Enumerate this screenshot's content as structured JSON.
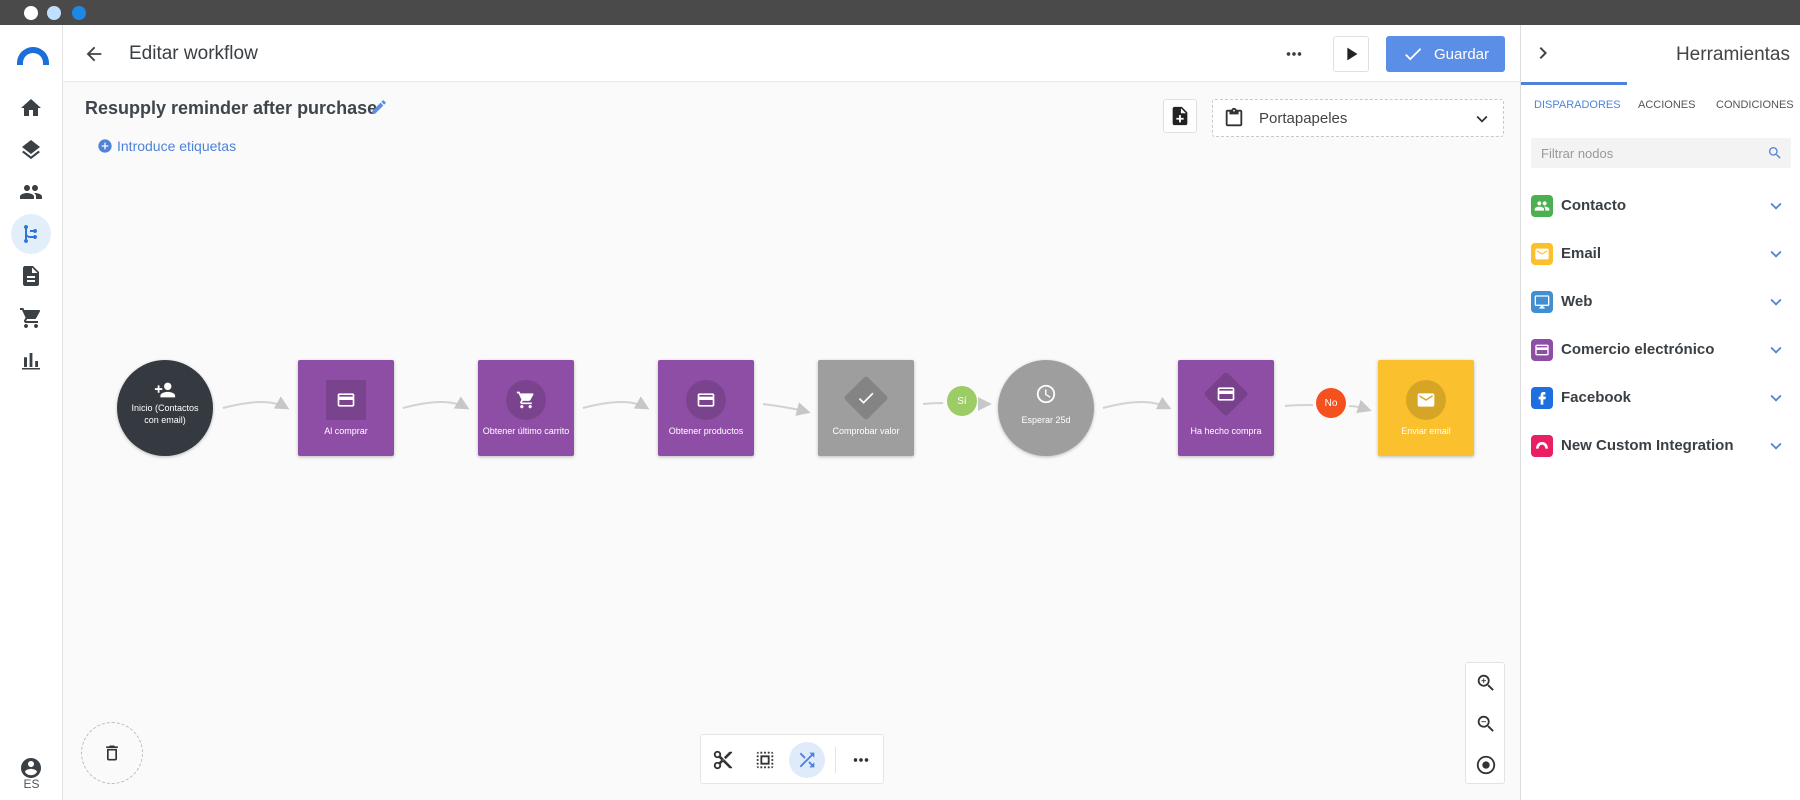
{
  "window": {
    "dots": [
      "#ffffff",
      "#bfe0ff",
      "#1e88e5"
    ]
  },
  "nav": {
    "items": [
      {
        "icon": "home-icon"
      },
      {
        "icon": "layers-icon"
      },
      {
        "icon": "people-icon"
      },
      {
        "icon": "workflow-icon",
        "active": true
      },
      {
        "icon": "document-icon"
      },
      {
        "icon": "cart-icon"
      },
      {
        "icon": "bar-chart-icon"
      }
    ],
    "language": "ES"
  },
  "header": {
    "title": "Editar workflow",
    "save_label": "Guardar"
  },
  "workflow": {
    "name": "Resupply reminder after purchase",
    "tags_link": "Introduce etiquetas",
    "clipboard_label": "Portapapeles",
    "nodes": [
      {
        "id": "inicio",
        "label": "Inicio (Contactos con email)",
        "shape": "circle",
        "color": "#343a40",
        "icon": "person-add-icon"
      },
      {
        "id": "al-comprar",
        "label": "Al comprar",
        "shape": "square",
        "color": "#8e4ea6",
        "icon": "credit-card-icon"
      },
      {
        "id": "obtener-carrito",
        "label": "Obtener último carrito",
        "shape": "square",
        "color": "#8e4ea6",
        "icon": "cart-icon"
      },
      {
        "id": "obtener-productos",
        "label": "Obtener productos",
        "shape": "square",
        "color": "#8e4ea6",
        "icon": "credit-card-icon"
      },
      {
        "id": "comprobar-valor",
        "label": "Comprobar valor",
        "shape": "square",
        "color": "#9e9e9e",
        "icon": "check-icon"
      },
      {
        "id": "esperar",
        "label": "Esperar 25d",
        "shape": "circle",
        "color": "#9e9e9e",
        "icon": "clock-icon"
      },
      {
        "id": "ha-hecho-compra",
        "label": "Ha hecho compra",
        "shape": "square",
        "color": "#8e4ea6",
        "icon": "credit-card-icon"
      },
      {
        "id": "enviar-email",
        "label": "Enviar email",
        "shape": "square",
        "color": "#fbc02d",
        "icon": "mail-icon"
      }
    ],
    "branch_badges": [
      {
        "label": "Sí",
        "color": "#9ccc65"
      },
      {
        "label": "No",
        "color": "#f4511e"
      }
    ]
  },
  "tools_panel": {
    "title": "Herramientas",
    "tabs": [
      "DISPARADORES",
      "ACCIONES",
      "CONDICIONES"
    ],
    "active_tab": "DISPARADORES",
    "filter_placeholder": "Filtrar nodos",
    "categories": [
      {
        "label": "Contacto",
        "color": "#4caf50",
        "icon": "people-icon"
      },
      {
        "label": "Email",
        "color": "#fbc02d",
        "icon": "mail-icon"
      },
      {
        "label": "Web",
        "color": "#3f8fd2",
        "icon": "monitor-icon"
      },
      {
        "label": "Comercio electrónico",
        "color": "#8e4ea6",
        "icon": "credit-card-icon"
      },
      {
        "label": "Facebook",
        "color": "#1e6fe0",
        "icon": "facebook-icon"
      },
      {
        "label": "New Custom Integration",
        "color": "#e91e63",
        "icon": "integration-icon"
      }
    ]
  }
}
